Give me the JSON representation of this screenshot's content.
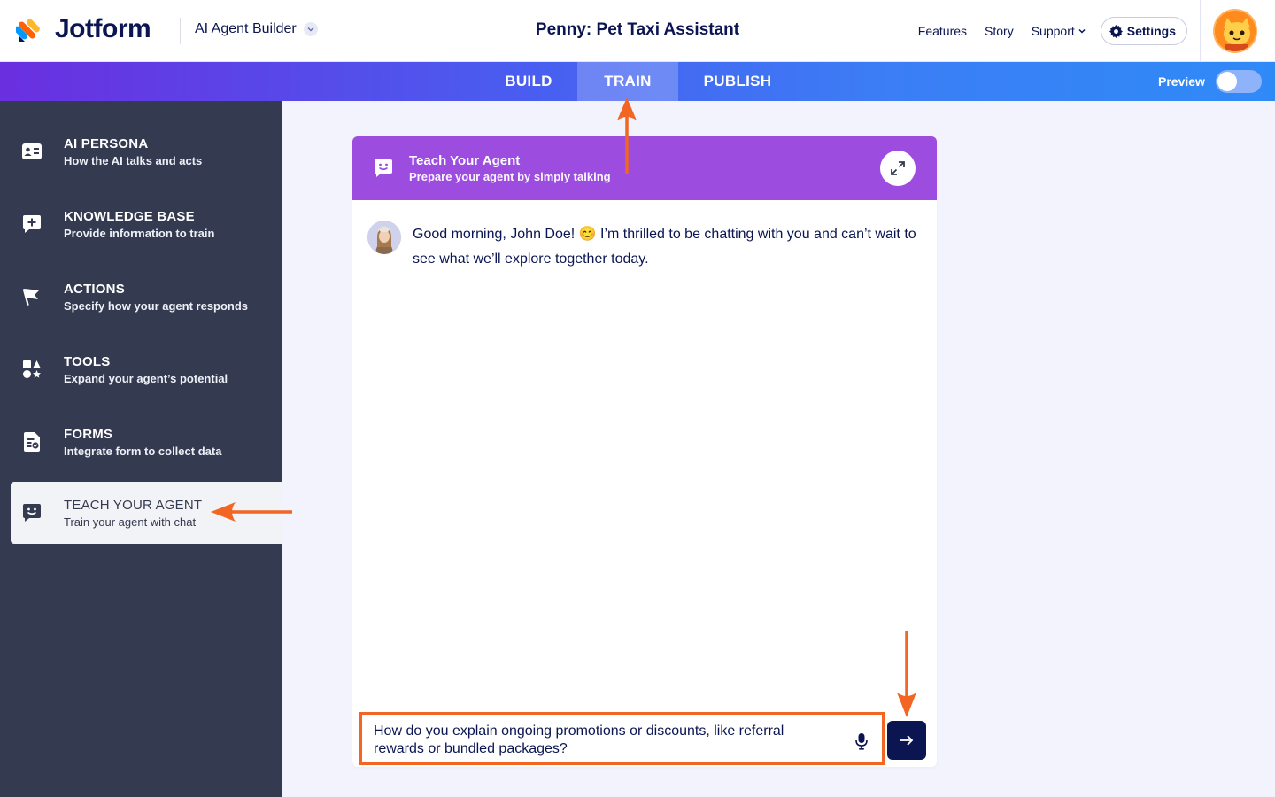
{
  "app": {
    "logo_text": "Jotform",
    "builder_label": "AI Agent Builder",
    "page_title": "Penny: Pet Taxi Assistant"
  },
  "top_links": {
    "features": "Features",
    "story": "Story",
    "support": "Support",
    "settings": "Settings"
  },
  "tabs": {
    "build": "BUILD",
    "train": "TRAIN",
    "publish": "PUBLISH",
    "active": "TRAIN"
  },
  "preview": {
    "label": "Preview",
    "enabled": false
  },
  "sidebar": {
    "items": [
      {
        "title": "AI PERSONA",
        "subtitle": "How the AI talks and acts",
        "icon": "id-card-icon"
      },
      {
        "title": "KNOWLEDGE BASE",
        "subtitle": "Provide information to train",
        "icon": "add-knowledge-icon"
      },
      {
        "title": "ACTIONS",
        "subtitle": "Specify how your agent responds",
        "icon": "flag-icon"
      },
      {
        "title": "TOOLS",
        "subtitle": "Expand your agent’s potential",
        "icon": "shapes-icon"
      },
      {
        "title": "FORMS",
        "subtitle": "Integrate form to collect data",
        "icon": "form-icon"
      },
      {
        "title": "TEACH YOUR AGENT",
        "subtitle": "Train your agent with chat",
        "icon": "smile-chat-icon"
      }
    ],
    "active_index": 5
  },
  "panel": {
    "title": "Teach Your Agent",
    "subtitle": "Prepare your agent by simply talking",
    "header_color": "#9c4ddf"
  },
  "chat": {
    "messages": [
      {
        "sender": "agent",
        "text": "Good morning, John Doe! 😊 I’m thrilled to be chatting with you and can’t wait to see what we’ll explore together today."
      }
    ],
    "input_value": "How do you explain ongoing promotions or discounts, like referral rewards or bundled packages?"
  },
  "colors": {
    "accent_orange": "#f26522",
    "navy": "#0a1551",
    "sidebar_bg": "#343a4f"
  }
}
